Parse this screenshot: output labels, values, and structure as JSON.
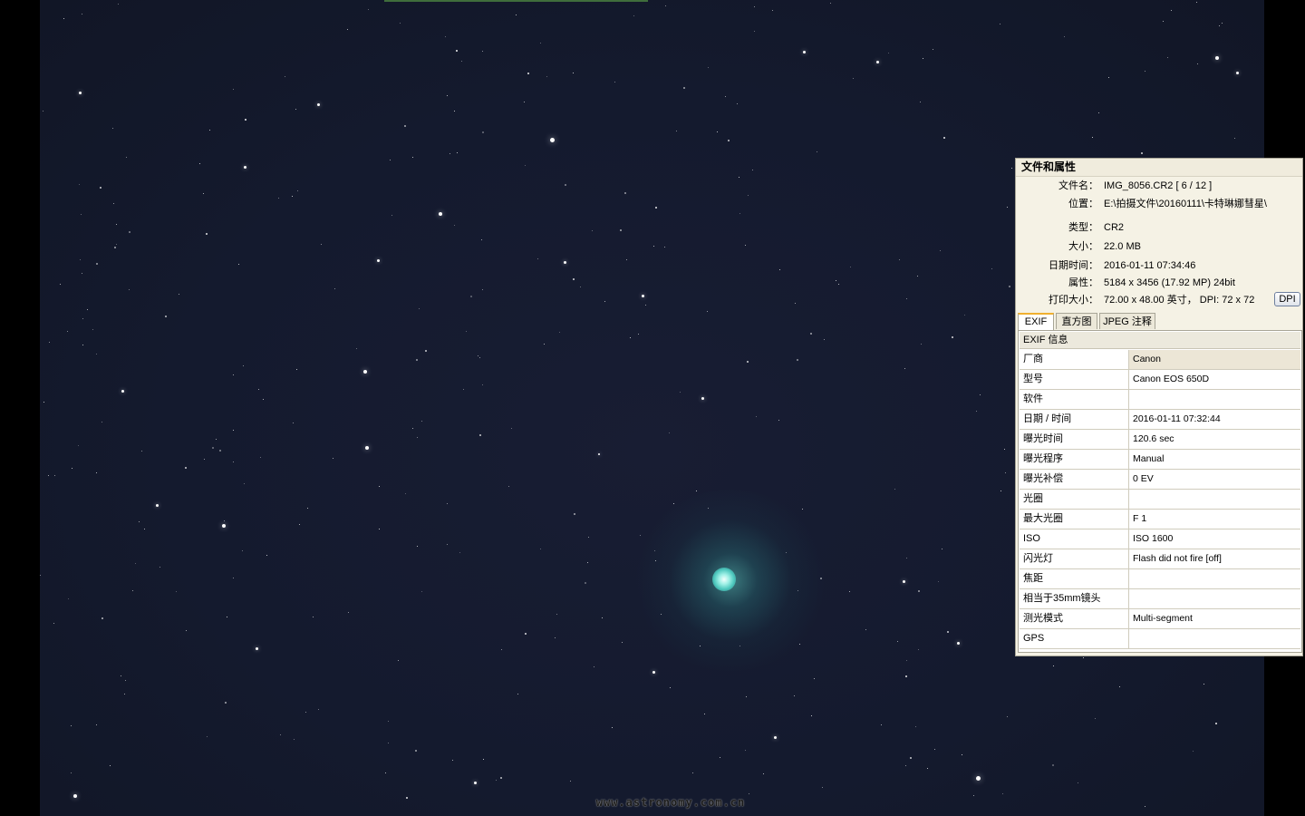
{
  "watermark": "www.astronomy.com.cn",
  "panel": {
    "title": "文件和属性",
    "properties": [
      {
        "label": "文件名：",
        "value": "IMG_8056.CR2  [ 6 / 12 ]"
      },
      {
        "label": "位置：",
        "value": "E:\\拍摄文件\\20160111\\卡特琳娜彗星\\"
      },
      {
        "label": "类型：",
        "value": "CR2"
      },
      {
        "label": "大小：",
        "value": "22.0 MB"
      },
      {
        "label": "日期时间：",
        "value": "2016-01-11 07:34:46"
      },
      {
        "label": "属性：",
        "value": "5184 x 3456 (17.92 MP)  24bit"
      },
      {
        "label": "打印大小：",
        "value": "72.00 x 48.00 英寸，  DPI: 72 x 72"
      }
    ],
    "dpi_button": "DPI",
    "tabs": [
      "EXIF",
      "直方图",
      "JPEG 注释"
    ],
    "active_tab": "EXIF",
    "exif_title": "EXIF 信息",
    "exif": [
      {
        "key": "厂商",
        "value": "Canon"
      },
      {
        "key": "型号",
        "value": "Canon EOS 650D"
      },
      {
        "key": "软件",
        "value": ""
      },
      {
        "key": "日期 / 时间",
        "value": "2016-01-11 07:32:44"
      },
      {
        "key": "曝光时间",
        "value": "120.6 sec"
      },
      {
        "key": "曝光程序",
        "value": "Manual"
      },
      {
        "key": "曝光补偿",
        "value": "0 EV"
      },
      {
        "key": "光圈",
        "value": ""
      },
      {
        "key": "最大光圈",
        "value": "F 1"
      },
      {
        "key": "ISO",
        "value": "ISO 1600"
      },
      {
        "key": "闪光灯",
        "value": "Flash did not fire [off]"
      },
      {
        "key": "焦距",
        "value": ""
      },
      {
        "key": "相当于35mm镜头",
        "value": ""
      },
      {
        "key": "测光模式",
        "value": "Multi-segment"
      },
      {
        "key": "GPS",
        "value": ""
      }
    ]
  }
}
